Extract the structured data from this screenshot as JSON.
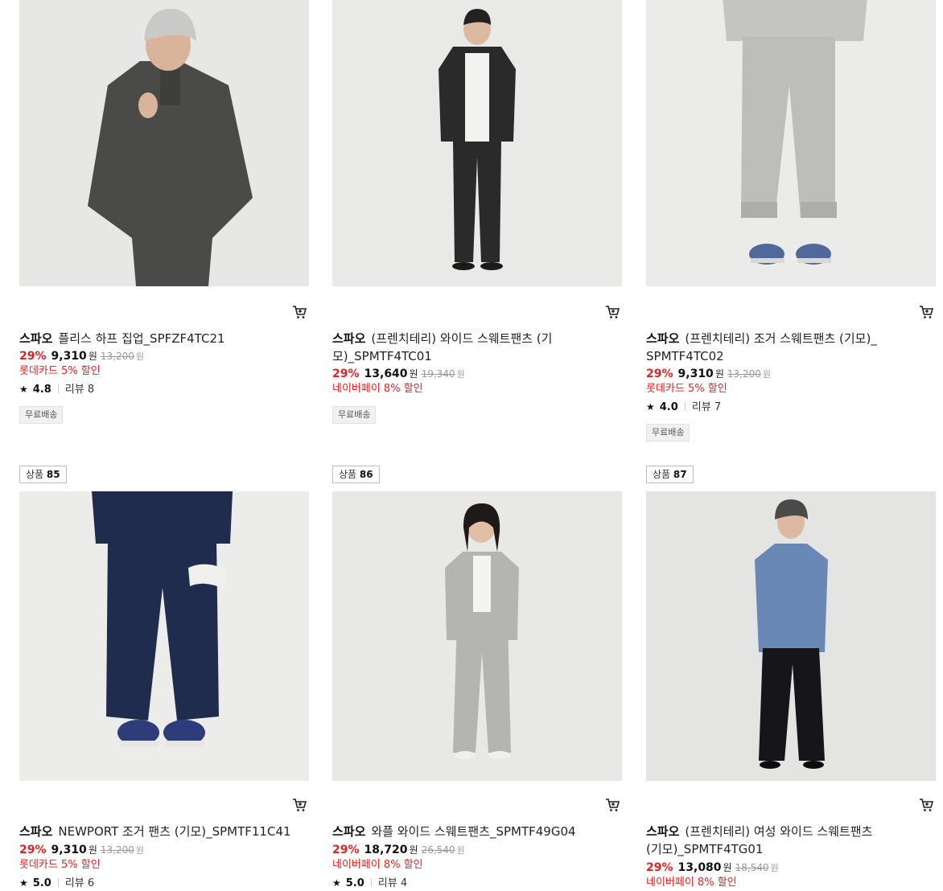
{
  "products": [
    {
      "brand": "스파오",
      "name": "플리스 하프 집업_SPFZF4TC21",
      "discount": "29%",
      "price": "9,310",
      "currency": "원",
      "original_price": "13,200",
      "promo": "롯데카드 5% 할인",
      "rating": "4.8",
      "review_label": "리뷰 8",
      "tag": "무료배송",
      "image_colors": {
        "bg": "#e7e7e5",
        "garment": "#4a4a48",
        "hat": "#c9c9c7",
        "skin": "#d9b49a"
      }
    },
    {
      "brand": "스파오",
      "name": "(프렌치테리) 와이드 스웨트팬츠 (기모)_SPMTF4TC01",
      "discount": "29%",
      "price": "13,640",
      "currency": "원",
      "original_price": "19,340",
      "promo": "네이버페이 8% 할인",
      "tag": "무료배송",
      "image_colors": {
        "bg": "#e9e9e7",
        "garment": "#2a2a2a",
        "shirt": "#f2f2f0",
        "skin": "#dcb9a0"
      }
    },
    {
      "brand": "스파오",
      "name": "(프렌치테리) 조거 스웨트팬츠 (기모)_SPMTF4TC02",
      "discount": "29%",
      "price": "9,310",
      "currency": "원",
      "original_price": "13,200",
      "promo": "롯데카드 5% 할인",
      "rating": "4.0",
      "review_label": "리뷰 7",
      "tag": "무료배송",
      "image_colors": {
        "bg": "#ebebe9",
        "garment": "#bdbdbb",
        "shoe": "#4f6a9a"
      }
    },
    {
      "rank_label": "상품",
      "rank_number": "85",
      "brand": "스파오",
      "name": "NEWPORT 조거 팬츠 (기모)_SPMTF11C41",
      "discount": "29%",
      "price": "9,310",
      "currency": "원",
      "original_price": "13,200",
      "promo": "롯데카드 5% 할인",
      "rating": "5.0",
      "review_label": "리뷰 6",
      "image_colors": {
        "bg": "#ececea",
        "garment": "#1f2c4e",
        "shoe": "#2e3c7a"
      }
    },
    {
      "rank_label": "상품",
      "rank_number": "86",
      "brand": "스파오",
      "name": "와플 와이드 스웨트팬츠_SPMTF49G04",
      "discount": "29%",
      "price": "18,720",
      "currency": "원",
      "original_price": "26,540",
      "promo": "네이버페이 8% 할인",
      "rating": "5.0",
      "review_label": "리뷰 4",
      "image_colors": {
        "bg": "#e8e8e6",
        "garment": "#b4b4b2",
        "shirt": "#f4f4f2",
        "skin": "#e0bfa6"
      }
    },
    {
      "rank_label": "상품",
      "rank_number": "87",
      "brand": "스파오",
      "name": "(프렌치테리) 여성 와이드 스웨트팬츠 (기모)_SPMTF4TG01",
      "discount": "29%",
      "price": "13,080",
      "currency": "원",
      "original_price": "18,540",
      "promo": "네이버페이 8% 할인",
      "image_colors": {
        "bg": "#e4e4e2",
        "garment": "#15151a",
        "top": "#6a88b6",
        "hat": "#4a4a4a",
        "skin": "#dcb9a0"
      }
    }
  ],
  "icons": {
    "cart": "cart-icon",
    "star": "star-icon"
  }
}
